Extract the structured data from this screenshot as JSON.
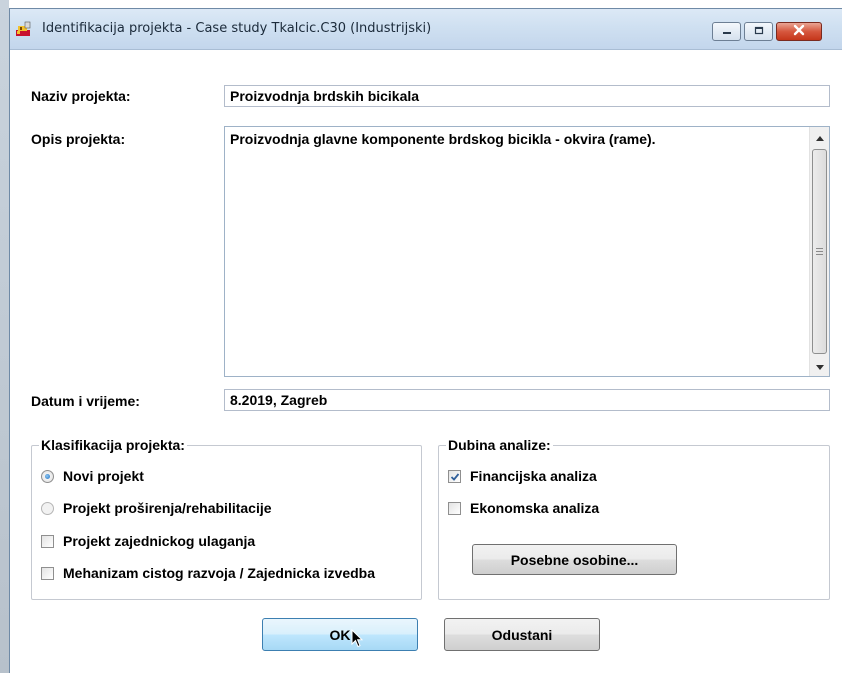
{
  "window": {
    "title": "Identifikacija projekta - Case study Tkalcic.C30 (Industrijski)"
  },
  "form": {
    "naziv_label": "Naziv projekta:",
    "naziv_value": "Proizvodnja brdskih bicikala",
    "opis_label": "Opis projekta:",
    "opis_value": "Proizvodnja glavne komponente brdskog bicikla - okvira (rame).",
    "datum_label": "Datum i vrijeme:",
    "datum_value": "8.2019, Zagreb"
  },
  "klasifikacija": {
    "legend": "Klasifikacija projekta:",
    "options": [
      {
        "label": "Novi projekt",
        "type": "radio",
        "selected": true
      },
      {
        "label": "Projekt proširenja/rehabilitacije",
        "type": "radio",
        "selected": false
      },
      {
        "label": "Projekt zajednickog ulaganja",
        "type": "checkbox",
        "checked": false
      },
      {
        "label": "Mehanizam cistog razvoja / Zajednicka izvedba",
        "type": "checkbox",
        "checked": false
      }
    ]
  },
  "dubina": {
    "legend": "Dubina analize:",
    "options": [
      {
        "label": "Financijska analiza",
        "type": "checkbox",
        "checked": true
      },
      {
        "label": "Ekonomska analiza",
        "type": "checkbox",
        "checked": false
      }
    ],
    "special_button": "Posebne osobine..."
  },
  "buttons": {
    "ok": "OK",
    "cancel": "Odustani"
  },
  "colors": {
    "titlebar": "#cfe0f1",
    "close_button": "#c5361b",
    "default_button": "#bee6fd"
  },
  "icons": {
    "app": "project-app-icon",
    "minimize": "minimize-icon",
    "maximize": "maximize-icon",
    "close": "close-icon"
  }
}
